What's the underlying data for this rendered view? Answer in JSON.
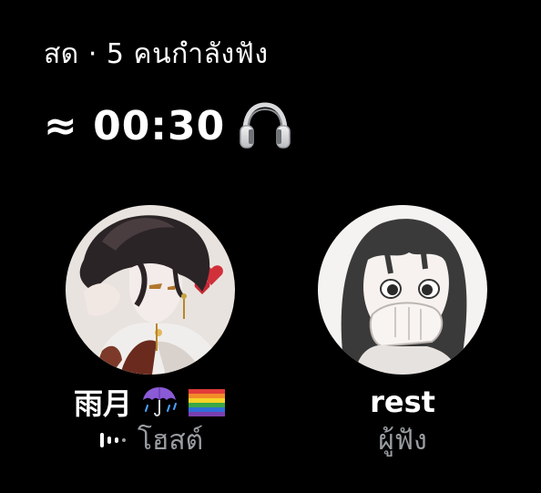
{
  "header": {
    "live_status": "สด · 5 คนกำลังฟัง"
  },
  "timer": {
    "elapsed": "≈ 00:30",
    "icon": "headphones-icon"
  },
  "participants": [
    {
      "name": "雨月",
      "role": "โฮสต์",
      "avatar": "avatar-anime-dark-hair",
      "badges": [
        "umbrella-rain-icon",
        "rainbow-flag-icon"
      ],
      "speaking": true
    },
    {
      "name": "rest",
      "role": "ผู้ฟัง",
      "avatar": "avatar-anime-girl",
      "badges": [],
      "speaking": false
    }
  ],
  "colors": {
    "background": "#000000",
    "text_primary": "#ffffff",
    "text_secondary": "#9a9ea3"
  }
}
